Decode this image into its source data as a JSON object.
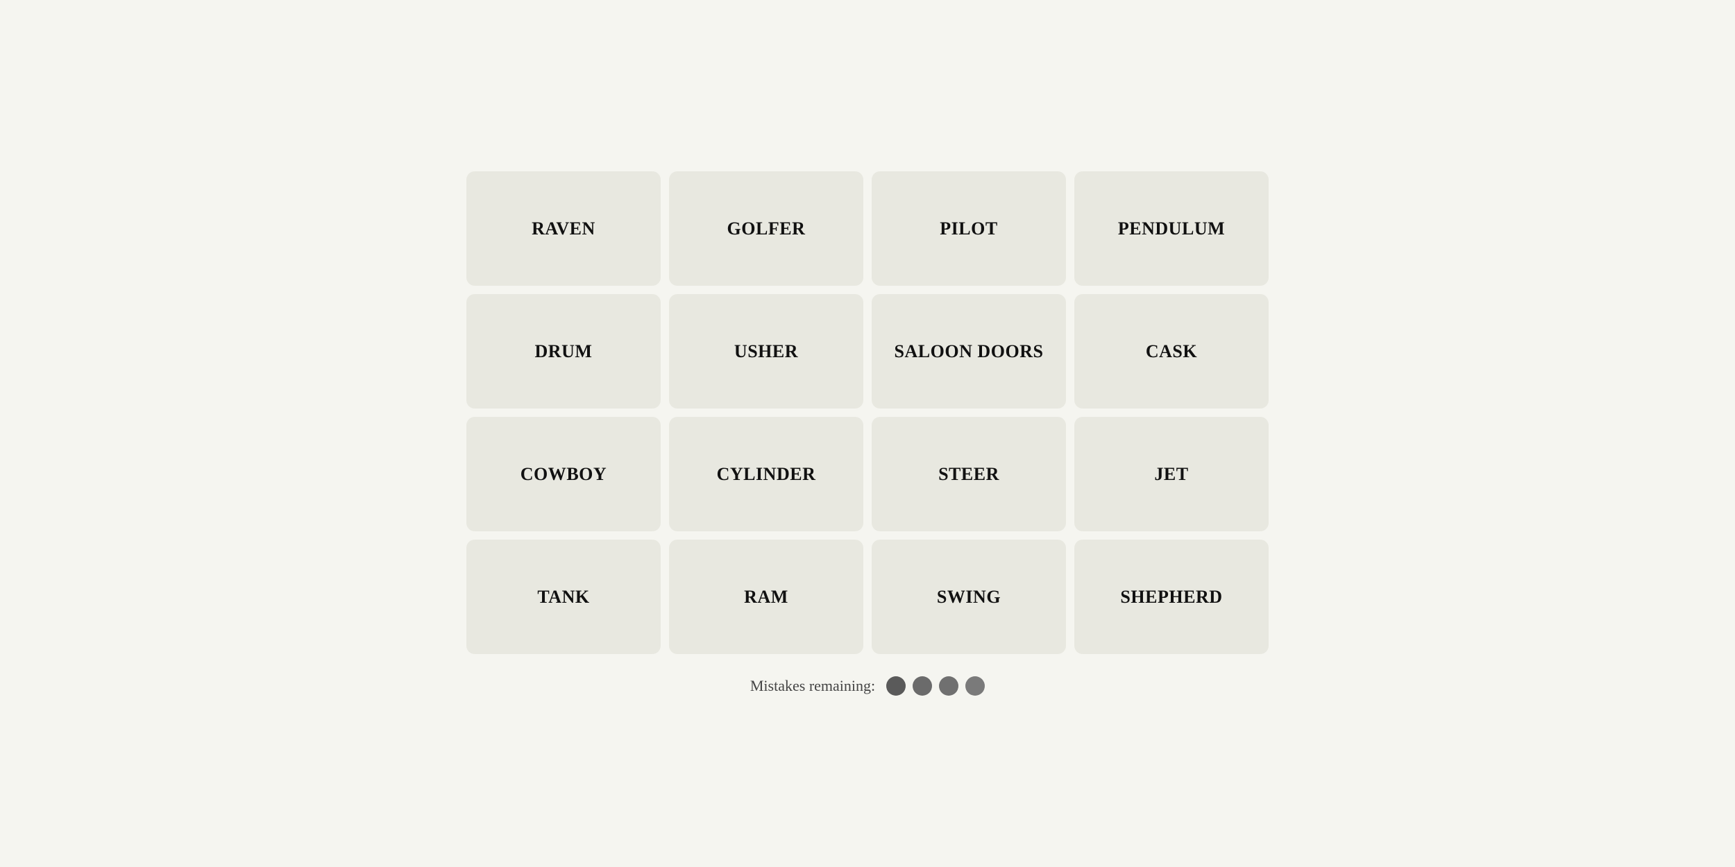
{
  "grid": {
    "tiles": [
      {
        "id": "raven",
        "label": "RAVEN"
      },
      {
        "id": "golfer",
        "label": "GOLFER"
      },
      {
        "id": "pilot",
        "label": "PILOT"
      },
      {
        "id": "pendulum",
        "label": "PENDULUM"
      },
      {
        "id": "drum",
        "label": "DRUM"
      },
      {
        "id": "usher",
        "label": "USHER"
      },
      {
        "id": "saloon-doors",
        "label": "SALOON DOORS"
      },
      {
        "id": "cask",
        "label": "CASK"
      },
      {
        "id": "cowboy",
        "label": "COWBOY"
      },
      {
        "id": "cylinder",
        "label": "CYLINDER"
      },
      {
        "id": "steer",
        "label": "STEER"
      },
      {
        "id": "jet",
        "label": "JET"
      },
      {
        "id": "tank",
        "label": "TANK"
      },
      {
        "id": "ram",
        "label": "RAM"
      },
      {
        "id": "swing",
        "label": "SWING"
      },
      {
        "id": "shepherd",
        "label": "SHEPHERD"
      }
    ]
  },
  "mistakes": {
    "label": "Mistakes remaining:",
    "count": 4
  }
}
